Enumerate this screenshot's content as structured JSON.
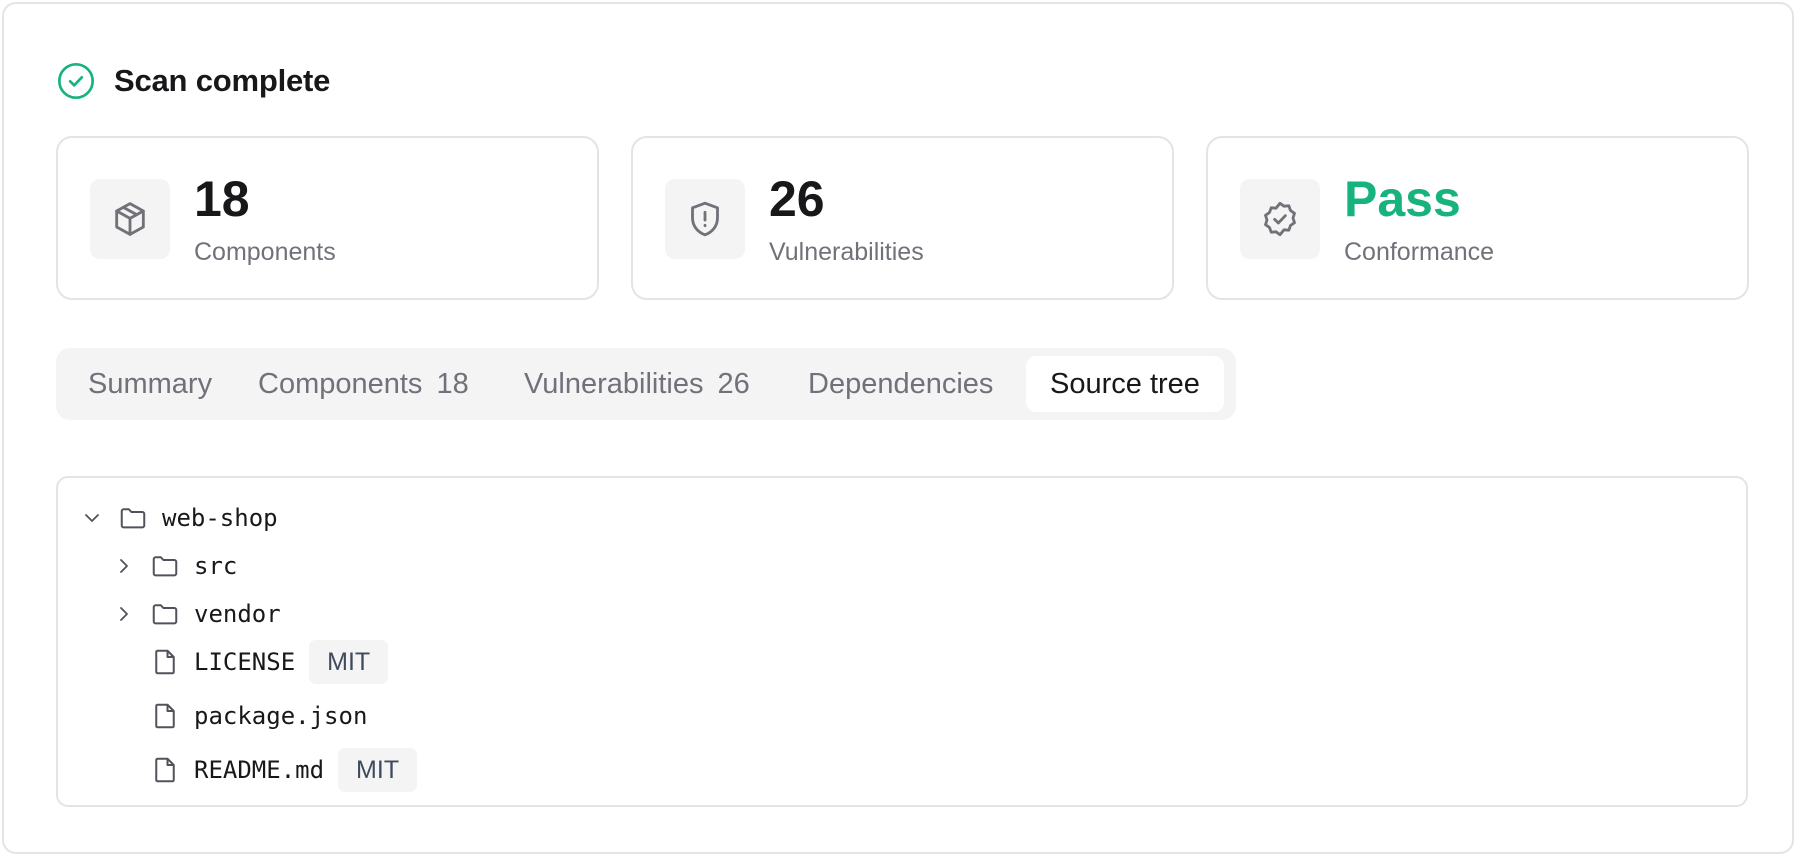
{
  "header": {
    "title": "Scan complete",
    "icon": "check-circle-icon",
    "accent": "#16b37d"
  },
  "stats": [
    {
      "value": "18",
      "label": "Components",
      "icon": "package-icon"
    },
    {
      "value": "26",
      "label": "Vulnerabilities",
      "icon": "shield-alert-icon"
    },
    {
      "value": "Pass",
      "label": "Conformance",
      "icon": "badge-check-icon",
      "color": "#16b37d"
    }
  ],
  "tabs": [
    {
      "label": "Summary",
      "count": ""
    },
    {
      "label": "Components",
      "count": "18"
    },
    {
      "label": "Vulnerabilities",
      "count": "26"
    },
    {
      "label": "Dependencies",
      "count": ""
    },
    {
      "label": "Source tree",
      "count": "",
      "active": true
    }
  ],
  "tree": {
    "root": {
      "name": "web-shop",
      "expanded": true,
      "icon": "folder-icon"
    },
    "children": [
      {
        "name": "src",
        "type": "folder",
        "expanded": false,
        "badge": ""
      },
      {
        "name": "vendor",
        "type": "folder",
        "expanded": false,
        "badge": ""
      },
      {
        "name": "LICENSE",
        "type": "file",
        "badge": "MIT"
      },
      {
        "name": "package.json",
        "type": "file",
        "badge": ""
      },
      {
        "name": "README.md",
        "type": "file",
        "badge": "MIT"
      }
    ]
  }
}
